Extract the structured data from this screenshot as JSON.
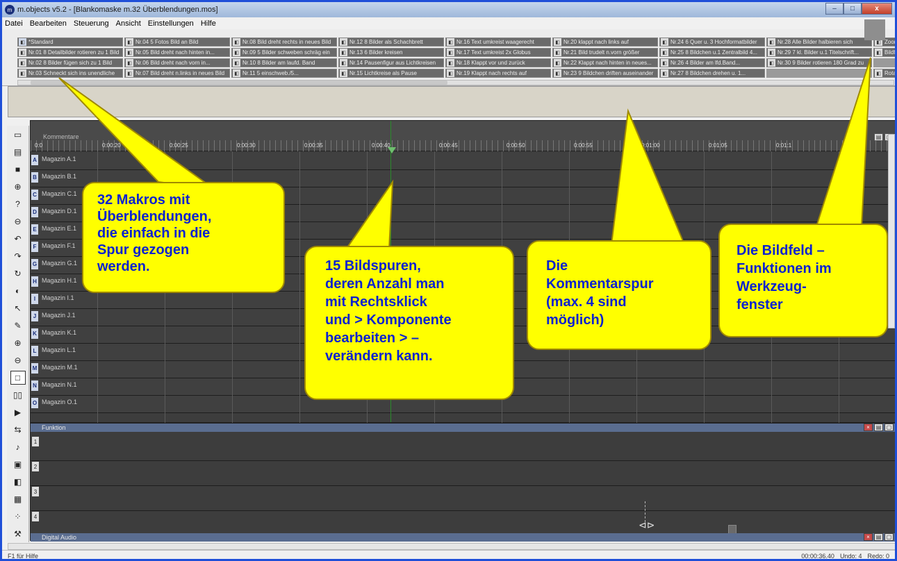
{
  "window": {
    "title": "m.objects v5.2 - [Blankomaske m.32 Überblendungen.mos]",
    "app_icon": "m",
    "buttons": {
      "minimize": "–",
      "maximize": "□",
      "close": "x"
    }
  },
  "menu": [
    "Datei",
    "Bearbeiten",
    "Steuerung",
    "Ansicht",
    "Einstellungen",
    "Hilfe"
  ],
  "macros": [
    "*Standard",
    "Nr.04 5 Fotos Bild an Bild",
    "Nr.08 Bild dreht rechts in neues Bild",
    "Nr.12 8 Bilder als Schachbrett",
    "Nr.16 Text umkreist waagerecht",
    "Nr.20 klappt nach links auf",
    "Nr.24 6 Quer u. 3 Hochformatbilder",
    "Nr.28 Alle Bilder halbieren sich",
    "Zoom",
    "Nr.01 8 Detailbilder rotieren zu 1 Bild",
    "Nr.05 Bild dreht nach hinten in...",
    "Nr.09 5 Bilder schweben schräg ein",
    "Nr.13 6 Bilder kreisen",
    "Nr.17 Text umkreist 2x Globus",
    "Nr.21 Bild trudelt n.vorn größer",
    "Nr.25 8 Bildchen u.1 Zentralbild 4...",
    "Nr.29 7 kl. Bilder u.1 Titelschrift...",
    "Bildfeld",
    "Nr.02 8 Bilder fügen sich zu 1 Bild",
    "Nr.06 Bild dreht nach vorn in...",
    "Nr.10 8 Bilder am laufd. Band",
    "Nr.14 Pausenfigur aus Lichtkreisen",
    "Nr.18 Klappt vor und zurück",
    "Nr.22 Klappt nach hinten in neues...",
    "Nr.26 4 Bilder am lfd.Band...",
    "Nr.30 9 Bilder rotieren 180 Grad zu",
    "",
    "Nr.03 Schneckt sich ins unendliche",
    "Nr.07 Bild dreht n.links in neues Bild",
    "Nr.11 5 einschweb./5...",
    "Nr.15 Lichtkreise als Pause",
    "Nr.19 Klappt nach rechts auf",
    "Nr.23 9 Bildchen driften auseinander",
    "Nr.27 8 Bildchen drehen u. 1...",
    "",
    "Rotation"
  ],
  "timeline": {
    "comment_label": "Kommentare",
    "ruler": [
      "0:0",
      "0:00:20",
      "0:00:25",
      "0:00:30",
      "0:00:35",
      "0:00:40",
      "0:00:45",
      "0:00:50",
      "0:00:55",
      "0:01:00",
      "0:01:05",
      "0:01:1"
    ],
    "tracks": [
      {
        "letter": "A",
        "name": "Magazin A.1"
      },
      {
        "letter": "B",
        "name": "Magazin B.1"
      },
      {
        "letter": "C",
        "name": "Magazin C.1"
      },
      {
        "letter": "D",
        "name": "Magazin D.1"
      },
      {
        "letter": "E",
        "name": "Magazin E.1"
      },
      {
        "letter": "F",
        "name": "Magazin F.1"
      },
      {
        "letter": "G",
        "name": "Magazin G.1"
      },
      {
        "letter": "H",
        "name": "Magazin H.1"
      },
      {
        "letter": "I",
        "name": "Magazin I.1"
      },
      {
        "letter": "J",
        "name": "Magazin J.1"
      },
      {
        "letter": "K",
        "name": "Magazin K.1"
      },
      {
        "letter": "L",
        "name": "Magazin L.1"
      },
      {
        "letter": "M",
        "name": "Magazin M.1"
      },
      {
        "letter": "N",
        "name": "Magazin N.1"
      },
      {
        "letter": "O",
        "name": "Magazin O.1"
      }
    ]
  },
  "functions": {
    "label": "Funktion",
    "rows": [
      "1",
      "2",
      "3",
      "4"
    ],
    "audio_label": "Digital Audio"
  },
  "status": {
    "help": "F1 für Hilfe",
    "time": "00:00:36.40",
    "undo": "Undo: 4",
    "redo": "Redo: 0"
  },
  "callouts": {
    "macros": [
      "32 Makros mit",
      "Überblendungen,",
      "die einfach in die",
      "Spur gezogen",
      "werden."
    ],
    "tracks": [
      "15 Bildspuren,",
      "deren Anzahl man",
      "mit Rechtsklick",
      "und > Komponente",
      "bearbeiten > –",
      "verändern kann."
    ],
    "comment": [
      "Die",
      "Kommentarspur",
      "(max. 4 sind",
      "möglich)"
    ],
    "bildfeld": [
      "Die Bildfeld –",
      "Funktionen im",
      "Werkzeug-",
      "fenster"
    ]
  },
  "colors": {
    "callout_fill": "#ffff00",
    "callout_text": "#0b22d0",
    "frame_border": "#1f4fd8"
  }
}
